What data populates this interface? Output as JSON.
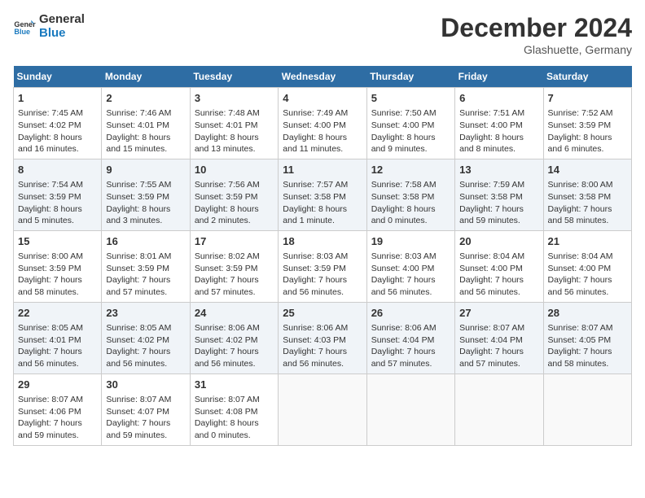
{
  "header": {
    "logo_line1": "General",
    "logo_line2": "Blue",
    "month": "December 2024",
    "location": "Glashuette, Germany"
  },
  "weekdays": [
    "Sunday",
    "Monday",
    "Tuesday",
    "Wednesday",
    "Thursday",
    "Friday",
    "Saturday"
  ],
  "weeks": [
    [
      {
        "day": "1",
        "lines": [
          "Sunrise: 7:45 AM",
          "Sunset: 4:02 PM",
          "Daylight: 8 hours",
          "and 16 minutes."
        ]
      },
      {
        "day": "2",
        "lines": [
          "Sunrise: 7:46 AM",
          "Sunset: 4:01 PM",
          "Daylight: 8 hours",
          "and 15 minutes."
        ]
      },
      {
        "day": "3",
        "lines": [
          "Sunrise: 7:48 AM",
          "Sunset: 4:01 PM",
          "Daylight: 8 hours",
          "and 13 minutes."
        ]
      },
      {
        "day": "4",
        "lines": [
          "Sunrise: 7:49 AM",
          "Sunset: 4:00 PM",
          "Daylight: 8 hours",
          "and 11 minutes."
        ]
      },
      {
        "day": "5",
        "lines": [
          "Sunrise: 7:50 AM",
          "Sunset: 4:00 PM",
          "Daylight: 8 hours",
          "and 9 minutes."
        ]
      },
      {
        "day": "6",
        "lines": [
          "Sunrise: 7:51 AM",
          "Sunset: 4:00 PM",
          "Daylight: 8 hours",
          "and 8 minutes."
        ]
      },
      {
        "day": "7",
        "lines": [
          "Sunrise: 7:52 AM",
          "Sunset: 3:59 PM",
          "Daylight: 8 hours",
          "and 6 minutes."
        ]
      }
    ],
    [
      {
        "day": "8",
        "lines": [
          "Sunrise: 7:54 AM",
          "Sunset: 3:59 PM",
          "Daylight: 8 hours",
          "and 5 minutes."
        ]
      },
      {
        "day": "9",
        "lines": [
          "Sunrise: 7:55 AM",
          "Sunset: 3:59 PM",
          "Daylight: 8 hours",
          "and 3 minutes."
        ]
      },
      {
        "day": "10",
        "lines": [
          "Sunrise: 7:56 AM",
          "Sunset: 3:59 PM",
          "Daylight: 8 hours",
          "and 2 minutes."
        ]
      },
      {
        "day": "11",
        "lines": [
          "Sunrise: 7:57 AM",
          "Sunset: 3:58 PM",
          "Daylight: 8 hours",
          "and 1 minute."
        ]
      },
      {
        "day": "12",
        "lines": [
          "Sunrise: 7:58 AM",
          "Sunset: 3:58 PM",
          "Daylight: 8 hours",
          "and 0 minutes."
        ]
      },
      {
        "day": "13",
        "lines": [
          "Sunrise: 7:59 AM",
          "Sunset: 3:58 PM",
          "Daylight: 7 hours",
          "and 59 minutes."
        ]
      },
      {
        "day": "14",
        "lines": [
          "Sunrise: 8:00 AM",
          "Sunset: 3:58 PM",
          "Daylight: 7 hours",
          "and 58 minutes."
        ]
      }
    ],
    [
      {
        "day": "15",
        "lines": [
          "Sunrise: 8:00 AM",
          "Sunset: 3:59 PM",
          "Daylight: 7 hours",
          "and 58 minutes."
        ]
      },
      {
        "day": "16",
        "lines": [
          "Sunrise: 8:01 AM",
          "Sunset: 3:59 PM",
          "Daylight: 7 hours",
          "and 57 minutes."
        ]
      },
      {
        "day": "17",
        "lines": [
          "Sunrise: 8:02 AM",
          "Sunset: 3:59 PM",
          "Daylight: 7 hours",
          "and 57 minutes."
        ]
      },
      {
        "day": "18",
        "lines": [
          "Sunrise: 8:03 AM",
          "Sunset: 3:59 PM",
          "Daylight: 7 hours",
          "and 56 minutes."
        ]
      },
      {
        "day": "19",
        "lines": [
          "Sunrise: 8:03 AM",
          "Sunset: 4:00 PM",
          "Daylight: 7 hours",
          "and 56 minutes."
        ]
      },
      {
        "day": "20",
        "lines": [
          "Sunrise: 8:04 AM",
          "Sunset: 4:00 PM",
          "Daylight: 7 hours",
          "and 56 minutes."
        ]
      },
      {
        "day": "21",
        "lines": [
          "Sunrise: 8:04 AM",
          "Sunset: 4:00 PM",
          "Daylight: 7 hours",
          "and 56 minutes."
        ]
      }
    ],
    [
      {
        "day": "22",
        "lines": [
          "Sunrise: 8:05 AM",
          "Sunset: 4:01 PM",
          "Daylight: 7 hours",
          "and 56 minutes."
        ]
      },
      {
        "day": "23",
        "lines": [
          "Sunrise: 8:05 AM",
          "Sunset: 4:02 PM",
          "Daylight: 7 hours",
          "and 56 minutes."
        ]
      },
      {
        "day": "24",
        "lines": [
          "Sunrise: 8:06 AM",
          "Sunset: 4:02 PM",
          "Daylight: 7 hours",
          "and 56 minutes."
        ]
      },
      {
        "day": "25",
        "lines": [
          "Sunrise: 8:06 AM",
          "Sunset: 4:03 PM",
          "Daylight: 7 hours",
          "and 56 minutes."
        ]
      },
      {
        "day": "26",
        "lines": [
          "Sunrise: 8:06 AM",
          "Sunset: 4:04 PM",
          "Daylight: 7 hours",
          "and 57 minutes."
        ]
      },
      {
        "day": "27",
        "lines": [
          "Sunrise: 8:07 AM",
          "Sunset: 4:04 PM",
          "Daylight: 7 hours",
          "and 57 minutes."
        ]
      },
      {
        "day": "28",
        "lines": [
          "Sunrise: 8:07 AM",
          "Sunset: 4:05 PM",
          "Daylight: 7 hours",
          "and 58 minutes."
        ]
      }
    ],
    [
      {
        "day": "29",
        "lines": [
          "Sunrise: 8:07 AM",
          "Sunset: 4:06 PM",
          "Daylight: 7 hours",
          "and 59 minutes."
        ]
      },
      {
        "day": "30",
        "lines": [
          "Sunrise: 8:07 AM",
          "Sunset: 4:07 PM",
          "Daylight: 7 hours",
          "and 59 minutes."
        ]
      },
      {
        "day": "31",
        "lines": [
          "Sunrise: 8:07 AM",
          "Sunset: 4:08 PM",
          "Daylight: 8 hours",
          "and 0 minutes."
        ]
      },
      null,
      null,
      null,
      null
    ]
  ]
}
